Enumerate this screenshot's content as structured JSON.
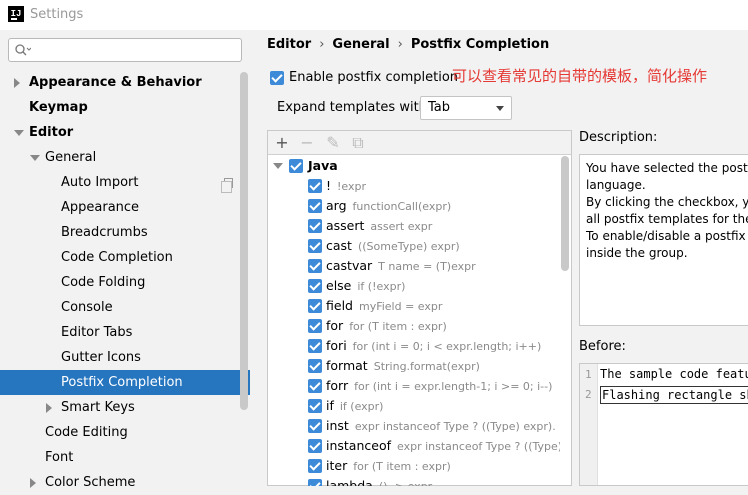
{
  "window": {
    "title": "Settings"
  },
  "search": {
    "placeholder": ""
  },
  "sidebar": {
    "items": [
      {
        "label": "Appearance & Behavior",
        "level": 0,
        "bold": true,
        "arrow": "right"
      },
      {
        "label": "Keymap",
        "level": 0,
        "bold": true,
        "arrow": "none"
      },
      {
        "label": "Editor",
        "level": 0,
        "bold": true,
        "arrow": "down"
      },
      {
        "label": "General",
        "level": 1,
        "bold": false,
        "arrow": "down"
      },
      {
        "label": "Auto Import",
        "level": 2,
        "bold": false,
        "arrow": "none",
        "icon": "copy-icon"
      },
      {
        "label": "Appearance",
        "level": 2,
        "bold": false,
        "arrow": "none"
      },
      {
        "label": "Breadcrumbs",
        "level": 2,
        "bold": false,
        "arrow": "none"
      },
      {
        "label": "Code Completion",
        "level": 2,
        "bold": false,
        "arrow": "none"
      },
      {
        "label": "Code Folding",
        "level": 2,
        "bold": false,
        "arrow": "none"
      },
      {
        "label": "Console",
        "level": 2,
        "bold": false,
        "arrow": "none"
      },
      {
        "label": "Editor Tabs",
        "level": 2,
        "bold": false,
        "arrow": "none"
      },
      {
        "label": "Gutter Icons",
        "level": 2,
        "bold": false,
        "arrow": "none"
      },
      {
        "label": "Postfix Completion",
        "level": 2,
        "bold": false,
        "arrow": "none",
        "selected": true
      },
      {
        "label": "Smart Keys",
        "level": 2,
        "bold": false,
        "arrow": "right"
      },
      {
        "label": "Code Editing",
        "level": 1,
        "bold": false,
        "arrow": "none"
      },
      {
        "label": "Font",
        "level": 1,
        "bold": false,
        "arrow": "none"
      },
      {
        "label": "Color Scheme",
        "level": 1,
        "bold": false,
        "arrow": "right"
      }
    ]
  },
  "breadcrumb": {
    "parts": [
      "Editor",
      "General",
      "Postfix Completion"
    ],
    "separator": "›"
  },
  "enable": {
    "label": "Enable postfix completion",
    "checked": true
  },
  "annotation": "可以查看常见的自带的模板，简化操作",
  "expand": {
    "label": "Expand templates with",
    "value": "Tab"
  },
  "toolbar": {
    "add": "+",
    "remove": "−",
    "edit": "✎",
    "copy": "⧉"
  },
  "templates": {
    "group": "Java",
    "items": [
      {
        "key": "!",
        "example": "!expr"
      },
      {
        "key": "arg",
        "example": "functionCall(expr)"
      },
      {
        "key": "assert",
        "example": "assert expr"
      },
      {
        "key": "cast",
        "example": "((SomeType) expr)"
      },
      {
        "key": "castvar",
        "example": "T name = (T)expr"
      },
      {
        "key": "else",
        "example": "if (!expr)"
      },
      {
        "key": "field",
        "example": "myField = expr"
      },
      {
        "key": "for",
        "example": "for (T item : expr)"
      },
      {
        "key": "fori",
        "example": "for (int i = 0; i < expr.length; i++)"
      },
      {
        "key": "format",
        "example": "String.format(expr)"
      },
      {
        "key": "forr",
        "example": "for (int i = expr.length-1; i >= 0; i--)"
      },
      {
        "key": "if",
        "example": "if (expr)"
      },
      {
        "key": "inst",
        "example": "expr instanceof Type ? ((Type) expr). : null"
      },
      {
        "key": "instanceof",
        "example": "expr instanceof Type ? ((Type) expr"
      },
      {
        "key": "iter",
        "example": "for (T item : expr)"
      },
      {
        "key": "lambda",
        "example": "() -> expr"
      }
    ]
  },
  "description": {
    "label": "Description:",
    "lines": [
      "You have selected the postfi",
      "language.",
      "By clicking the checkbox, yo",
      "all postfix templates for the",
      "To enable/disable a postfix",
      "inside the group."
    ]
  },
  "before": {
    "label": "Before:",
    "lines": [
      {
        "num": "1",
        "text": "The sample code featur"
      },
      {
        "num": "2",
        "text": "Flashing rectangle sh"
      }
    ]
  },
  "colors": {
    "selection": "#2675bf",
    "checkbox": "#3c8ad8",
    "annotation": "#e53935"
  }
}
